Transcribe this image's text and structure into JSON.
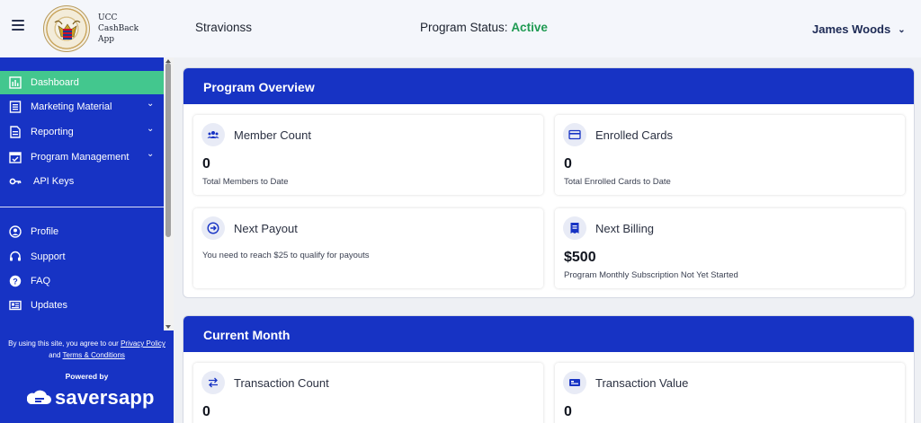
{
  "header": {
    "logo_lines": [
      "UCC",
      "CashBack",
      "App"
    ],
    "program_name": "Stravionss",
    "status_label": "Program Status:",
    "status_value": "Active",
    "user_name": "James Woods"
  },
  "sidebar": {
    "items": [
      {
        "label": "Dashboard",
        "icon": "chart-bar-icon",
        "active": true
      },
      {
        "label": "Marketing Material",
        "icon": "document-list-icon",
        "expandable": true
      },
      {
        "label": "Reporting",
        "icon": "report-icon",
        "expandable": true
      },
      {
        "label": "Program Management",
        "icon": "calendar-check-icon",
        "expandable": true
      },
      {
        "label": "API Keys",
        "icon": "key-icon"
      },
      {
        "label": "Profile",
        "icon": "user-circle-icon"
      },
      {
        "label": "Support",
        "icon": "headset-icon"
      },
      {
        "label": "FAQ",
        "icon": "question-icon"
      },
      {
        "label": "Updates",
        "icon": "newspaper-icon"
      }
    ],
    "legal_prefix": "By using this site, you agree to our",
    "privacy_link": "Privacy Policy",
    "legal_and": "and",
    "terms_link": "Terms & Conditions",
    "powered_by": "Powered by",
    "brand": "saversapp"
  },
  "overview": {
    "title": "Program Overview",
    "member_count": {
      "title": "Member Count",
      "value": "0",
      "subtitle": "Total Members to Date"
    },
    "enrolled_cards": {
      "title": "Enrolled Cards",
      "value": "0",
      "subtitle": "Total Enrolled Cards to Date"
    },
    "next_payout": {
      "title": "Next Payout",
      "note": "You need to reach $25 to qualify for payouts"
    },
    "next_billing": {
      "title": "Next Billing",
      "value": "$500",
      "subtitle": "Program Monthly Subscription Not Yet Started"
    }
  },
  "current_month": {
    "title": "Current Month",
    "transaction_count": {
      "title": "Transaction Count",
      "value": "0"
    },
    "transaction_value": {
      "title": "Transaction Value",
      "value": "0"
    }
  },
  "colors": {
    "primary": "#1733c4",
    "active_nav": "#43c78e",
    "status_active": "#1f9a52"
  }
}
